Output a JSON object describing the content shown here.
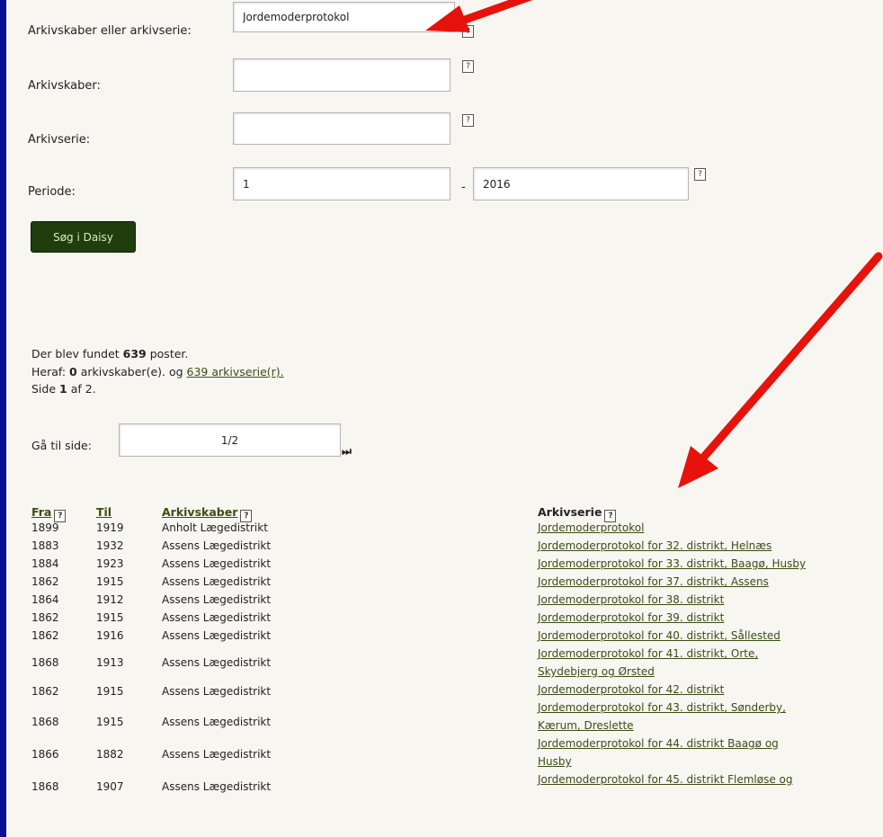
{
  "form": {
    "archive_creator_or_series_label": "Arkivskaber eller arkivserie:",
    "archive_creator_or_series_value": "Jordemoderprotokol",
    "archive_creator_label": "Arkivskaber:",
    "archive_creator_value": "",
    "archive_series_label": "Arkivserie:",
    "archive_series_value": "",
    "period_label": "Periode:",
    "period_from": "1",
    "period_dash": "-",
    "period_to": "2016",
    "help_glyph": "?",
    "search_button": "Søg i Daisy"
  },
  "results": {
    "found_prefix": "Der blev fundet ",
    "found_count": "639",
    "found_suffix": " poster.",
    "heraf_prefix": "Heraf: ",
    "creators_count": "0",
    "creators_text": " arkivskaber(e). og ",
    "series_link": "639 arkivserie(r).",
    "page_prefix": "Side ",
    "page_current": "1",
    "page_suffix": " af 2.",
    "goto_label": "Gå til side:",
    "goto_value": "1/2",
    "last_page_glyph": "⏭"
  },
  "table": {
    "headers": {
      "from": "Fra",
      "to": "Til",
      "creator": "Arkivskaber",
      "series": "Arkivserie"
    },
    "rows": [
      {
        "from": "1899",
        "to": "1919",
        "creator": "Anholt Lægedistrikt"
      },
      {
        "from": "1883",
        "to": "1932",
        "creator": "Assens Lægedistrikt"
      },
      {
        "from": "1884",
        "to": "1923",
        "creator": "Assens Lægedistrikt"
      },
      {
        "from": "1862",
        "to": "1915",
        "creator": "Assens Lægedistrikt"
      },
      {
        "from": "1864",
        "to": "1912",
        "creator": "Assens Lægedistrikt"
      },
      {
        "from": "1862",
        "to": "1915",
        "creator": "Assens Lægedistrikt"
      },
      {
        "from": "1862",
        "to": "1916",
        "creator": "Assens Lægedistrikt"
      },
      {
        "from": "1868",
        "to": "1913",
        "creator": "Assens Lægedistrikt"
      },
      {
        "from": "1862",
        "to": "1915",
        "creator": "Assens Lægedistrikt"
      },
      {
        "from": "1868",
        "to": "1915",
        "creator": "Assens Lægedistrikt"
      },
      {
        "from": "1866",
        "to": "1882",
        "creator": "Assens Lægedistrikt"
      },
      {
        "from": "1868",
        "to": "1907",
        "creator": "Assens Lægedistrikt"
      }
    ],
    "series_lines": [
      "Jordemoderprotokol",
      "Jordemoderprotokol for 32. distrikt, Helnæs",
      "Jordemoderprotokol for 33. distrikt, Baagø, Husby",
      "Jordemoderprotokol for 37. distrikt, Assens",
      "Jordemoderprotokol for 38. distrikt",
      "Jordemoderprotokol for 39. distrikt",
      "Jordemoderprotokol for 40. distrikt, Sållested",
      "Jordemoderprotokol for 41. distrikt, Orte,",
      "Skydebjerg og Ørsted",
      "Jordemoderprotokol for 42. distrikt",
      "Jordemoderprotokol for 43. distrikt, Sønderby,",
      "Kærum, Dreslette",
      "Jordemoderprotokol for 44. distrikt Baagø og",
      "Husby",
      "Jordemoderprotokol for 45. distrikt Flemløse og"
    ]
  },
  "colors": {
    "frame": "#0a1190",
    "page_bg": "#f7f6f1",
    "button_bg": "#1f3d0d",
    "link": "#3c4d16",
    "annotation_arrow": "#e8120c"
  }
}
